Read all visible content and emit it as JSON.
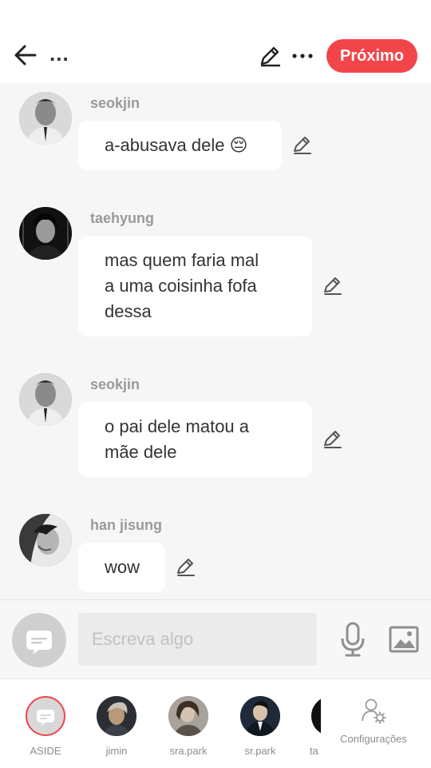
{
  "header": {
    "title": "...",
    "next_label": "Próximo"
  },
  "messages": [
    {
      "sender": "seokjin",
      "lines": [
        "a-abusava dele 😔"
      ]
    },
    {
      "sender": "taehyung",
      "lines": [
        "mas quem faria mal",
        "a uma coisinha fofa",
        "dessa"
      ]
    },
    {
      "sender": "seokjin",
      "lines": [
        "o pai dele matou a",
        "mãe dele"
      ]
    },
    {
      "sender": "han jisung",
      "lines": [
        "wow"
      ]
    }
  ],
  "composer": {
    "placeholder": "Escreva algo"
  },
  "characters": [
    {
      "label": "ASIDE"
    },
    {
      "label": "jimin"
    },
    {
      "label": "sra.park"
    },
    {
      "label": "sr.park"
    },
    {
      "label": "ta"
    }
  ],
  "settings": {
    "label": "Configurações"
  },
  "colors": {
    "accent": "#f2454a",
    "background": "#f6f6f6",
    "bubble": "#ffffff",
    "sender": "#9a9a9a"
  }
}
